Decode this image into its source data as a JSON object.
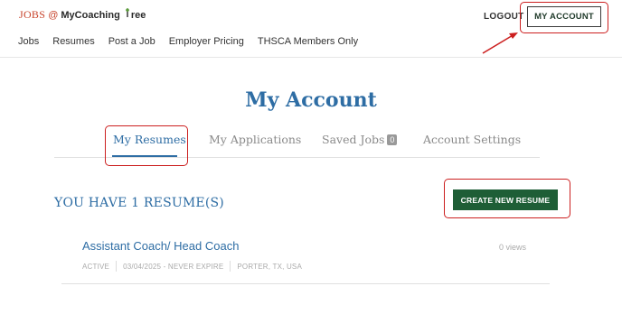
{
  "header": {
    "logo": {
      "jobs": "JOBS",
      "at": "@",
      "brand_prefix": "MyCoaching",
      "brand_suffix": "ree",
      "tree_icon": "tree-icon"
    },
    "logout_label": "LOGOUT",
    "my_account_label": "MY ACCOUNT",
    "nav": [
      "Jobs",
      "Resumes",
      "Post a Job",
      "Employer Pricing",
      "THSCA Members Only"
    ]
  },
  "page": {
    "title": "My Account",
    "tabs": [
      {
        "label": "My Resumes",
        "active": true
      },
      {
        "label": "My Applications",
        "active": false
      },
      {
        "label": "Saved Jobs",
        "badge": "0",
        "active": false
      },
      {
        "label": "Account Settings",
        "active": false
      }
    ],
    "resume_count_text": "YOU HAVE 1 RESUME(S)",
    "create_button_label": "CREATE NEW RESUME",
    "resumes": [
      {
        "title": "Assistant Coach/ Head Coach",
        "views": "0 views",
        "status": "ACTIVE",
        "dates": "03/04/2025 - NEVER EXPIRE",
        "location": "PORTER, TX, USA"
      }
    ]
  },
  "colors": {
    "accent_blue": "#2e6da4",
    "brand_green": "#1e5e36",
    "logo_red": "#c8442c",
    "annotation_red": "#cc1f1f"
  }
}
